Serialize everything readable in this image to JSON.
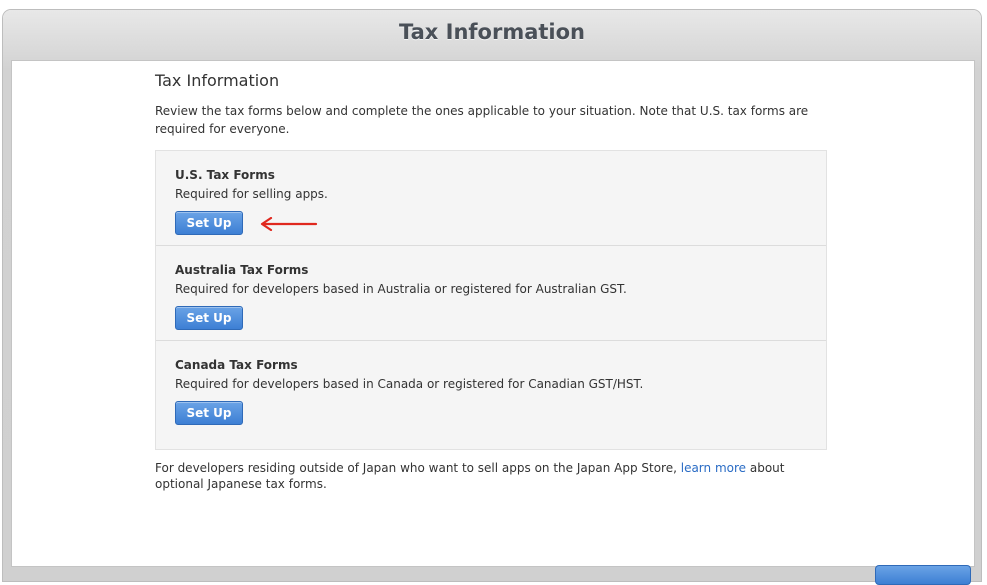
{
  "window": {
    "title": "Tax Information"
  },
  "page": {
    "title": "Tax Information",
    "intro": "Review the tax forms below and complete the ones applicable to your situation. Note that U.S. tax forms are required for everyone."
  },
  "forms": [
    {
      "title": "U.S. Tax Forms",
      "description": "Required for selling apps.",
      "button_label": "Set Up"
    },
    {
      "title": "Australia Tax Forms",
      "description": "Required for developers based in Australia or registered for Australian GST.",
      "button_label": "Set Up"
    },
    {
      "title": "Canada Tax Forms",
      "description": "Required for developers based in Canada or registered for Canadian GST/HST.",
      "button_label": "Set Up"
    }
  ],
  "footer": {
    "text_before": "For developers residing outside of Japan who want to sell apps on the Japan App Store, ",
    "link_text": "learn more",
    "text_after": " about optional Japanese tax forms."
  },
  "colors": {
    "button_blue": "#3d7fd4",
    "link_blue": "#2a6cc5",
    "arrow_red": "#e0281e"
  },
  "icons": {
    "annotation_arrow": "left-arrow-icon"
  }
}
